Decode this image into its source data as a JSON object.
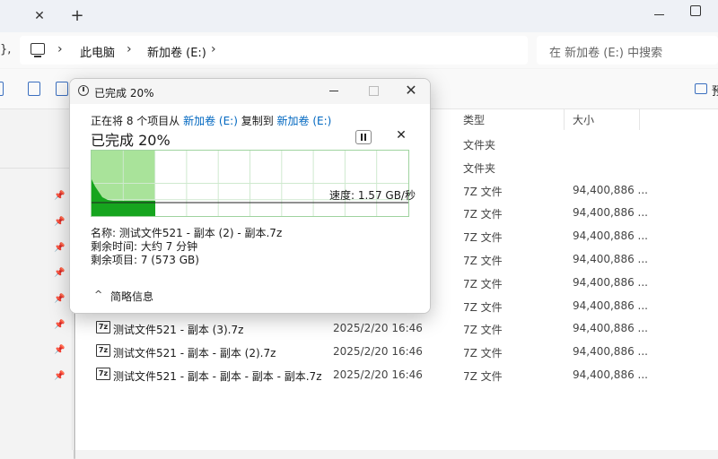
{
  "titlebar": {
    "close_glyph": "✕",
    "add_glyph": "+"
  },
  "address": {
    "left_glyph": "},",
    "crumbs": [
      "此电脑",
      "新加卷 (E:)"
    ],
    "separator": "›",
    "search_placeholder": "在 新加卷 (E:) 中搜索"
  },
  "toolbar": {
    "right_label": "预"
  },
  "columns": {
    "type": "类型",
    "size": "大小"
  },
  "rows": [
    {
      "name": "",
      "date": "",
      "type": "文件夹",
      "size": ""
    },
    {
      "name": "",
      "date": "",
      "type": "文件夹",
      "size": ""
    },
    {
      "name": "",
      "date": "",
      "type": "7Z 文件",
      "size": "94,400,886 ..."
    },
    {
      "name": "",
      "date": "",
      "type": "7Z 文件",
      "size": "94,400,886 ..."
    },
    {
      "name": "",
      "date": "",
      "type": "7Z 文件",
      "size": "94,400,886 ..."
    },
    {
      "name": "",
      "date": "",
      "type": "7Z 文件",
      "size": "94,400,886 ..."
    },
    {
      "name": "",
      "date": "",
      "type": "7Z 文件",
      "size": "94,400,886 ..."
    },
    {
      "name": "",
      "date": "",
      "type": "7Z 文件",
      "size": "94,400,886 ..."
    },
    {
      "name": "测试文件521 - 副本 (3).7z",
      "date": "2025/2/20 16:46",
      "type": "7Z 文件",
      "size": "94,400,886 ..."
    },
    {
      "name": "测试文件521 - 副本 - 副本 (2).7z",
      "date": "2025/2/20 16:46",
      "type": "7Z 文件",
      "size": "94,400,886 ..."
    },
    {
      "name": "测试文件521 - 副本 - 副本 - 副本 - 副本.7z",
      "date": "2025/2/20 16:46",
      "type": "7Z 文件",
      "size": "94,400,886 ..."
    }
  ],
  "file_icon_label": "7z",
  "pin_glyph": "📌",
  "dialog": {
    "title": "已完成 20%",
    "minimize_glyph": "—",
    "close_glyph": "✕",
    "copy_prefix": "正在将 8 个项目从 ",
    "source": "新加卷 (E:)",
    "copy_mid": " 复制到 ",
    "dest": "新加卷 (E:)",
    "percent_text": "已完成 20%",
    "cancel_glyph": "✕",
    "progress": 0.2,
    "speed_text": "速度: 1.57 GB/秒",
    "name_line": "名称: 测试文件521 - 副本 (2) - 副本.7z",
    "time_line": "剩余时间: 大约 7 分钟",
    "items_line": "剩余项目: 7 (573 GB)",
    "details_chevron": "^",
    "details_label": "简略信息"
  },
  "colors": {
    "accent": "#0067c0",
    "progress_fill": "#a9e39a",
    "progress_dark": "#16a51e"
  }
}
